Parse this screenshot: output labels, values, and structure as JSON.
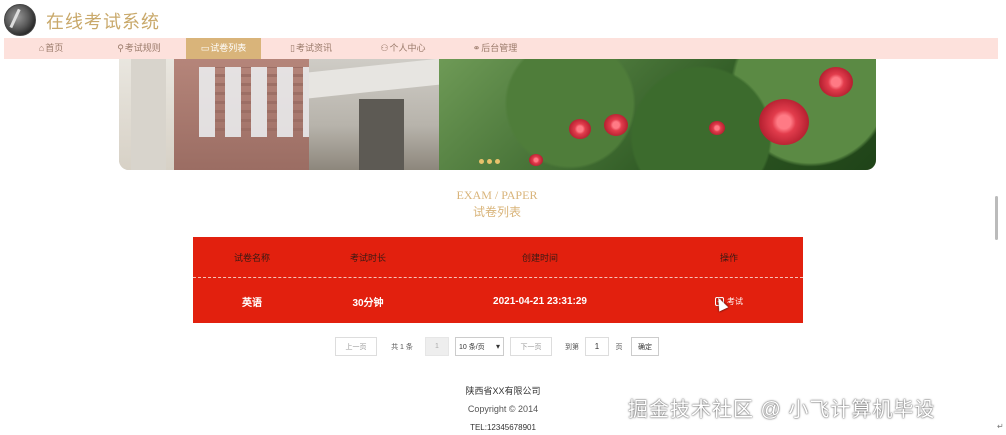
{
  "header": {
    "logo_icon": "leaf-logo-icon",
    "title": "在线考试系统",
    "title_color": "#c9a96b"
  },
  "nav": {
    "items": [
      {
        "icon": "home-icon",
        "glyph": "⌂",
        "label": "首页"
      },
      {
        "icon": "tag-icon",
        "glyph": "⚲",
        "label": "考试规则"
      },
      {
        "icon": "paper-icon",
        "glyph": "▭",
        "label": "试卷列表",
        "active": true
      },
      {
        "icon": "document-icon",
        "glyph": "▯",
        "label": "考试资讯"
      },
      {
        "icon": "user-icon",
        "glyph": "⚇",
        "label": "个人中心"
      },
      {
        "icon": "link-icon",
        "glyph": "⚭",
        "label": "后台管理"
      }
    ],
    "bg_color": "#fde1dc",
    "active_color": "#d9b47a"
  },
  "section": {
    "title_en": "EXAM / PAPER",
    "title_cn": "试卷列表",
    "color": "#d9b47a"
  },
  "table": {
    "bg_color": "#e2200e",
    "headers": [
      "试卷名称",
      "考试时长",
      "创建时间",
      "操作"
    ],
    "rows": [
      {
        "name": "英语",
        "duration": "30分钟",
        "created": "2021-04-21 23:31:29",
        "action": "考试"
      }
    ]
  },
  "pagination": {
    "prev": "上一页",
    "total": "共 1 条",
    "current_page": "1",
    "page_size": "10 条/页",
    "next": "下一页",
    "goto_label": "到第",
    "goto_value": "1",
    "page_unit": "页",
    "confirm": "确定"
  },
  "footer": {
    "company": "陕西省XX有限公司",
    "copyright": "Copyright © 2014",
    "tel": "TEL:12345678901"
  },
  "watermark": "掘金技术社区 @ 小飞计算机毕设"
}
